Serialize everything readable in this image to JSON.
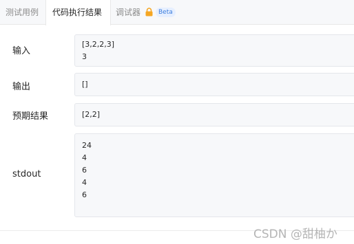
{
  "tabs": {
    "test_cases": "测试用例",
    "run_result": "代码执行结果",
    "debugger": "调试器",
    "beta": "Beta"
  },
  "icons": {
    "lock": "lock-icon",
    "lock_color": "#f5a623"
  },
  "rows": {
    "input": {
      "label": "输入",
      "lines": [
        "[3,2,2,3]",
        "3"
      ]
    },
    "output": {
      "label": "输出",
      "lines": [
        "[]"
      ]
    },
    "expected": {
      "label": "预期结果",
      "lines": [
        "[2,2]"
      ]
    },
    "stdout": {
      "label": "stdout",
      "lines": [
        "24",
        "4",
        "6",
        "4",
        "6"
      ]
    }
  },
  "watermark": "CSDN @甜柚か"
}
